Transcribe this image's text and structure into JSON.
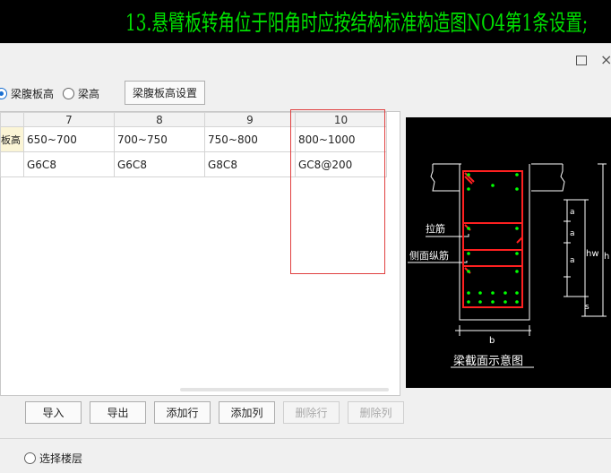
{
  "banner": {
    "text": "13.悬臂板转角位于阳角时应按结构标准构造图NO4第1条设置;"
  },
  "window": {
    "maximize_glyph": "",
    "close_glyph": "×"
  },
  "height_mode": {
    "options": [
      {
        "label": "梁腹板高",
        "selected": true
      },
      {
        "label": "梁高",
        "selected": false
      }
    ],
    "settings_button": "梁腹板高设置"
  },
  "table": {
    "columns": [
      "7",
      "8",
      "9",
      "10"
    ],
    "row_label": "板高",
    "rows": [
      [
        "650~700",
        "700~750",
        "750~800",
        "800~1000"
      ],
      [
        "G6C8",
        "G6C8",
        "G8C8",
        "GC8@200"
      ]
    ]
  },
  "actions": {
    "import": "导入",
    "export": "导出",
    "add_row": "添加行",
    "add_col": "添加列",
    "delete_row": "删除行",
    "delete_col": "删除列"
  },
  "floor_select": {
    "label": "选择楼层",
    "selected": false
  },
  "diagram": {
    "title": "梁截面示意图",
    "tie_label": "拉筋",
    "side_bar_label": "侧面纵筋",
    "dim_a": "a",
    "dim_hw": "hw",
    "dim_h": "h",
    "dim_s": "s",
    "dim_b": "b"
  },
  "colors": {
    "banner_text": "#00e000",
    "highlight": "#e04040",
    "rebar": "#ff2020",
    "bar_dot": "#00ff00"
  }
}
